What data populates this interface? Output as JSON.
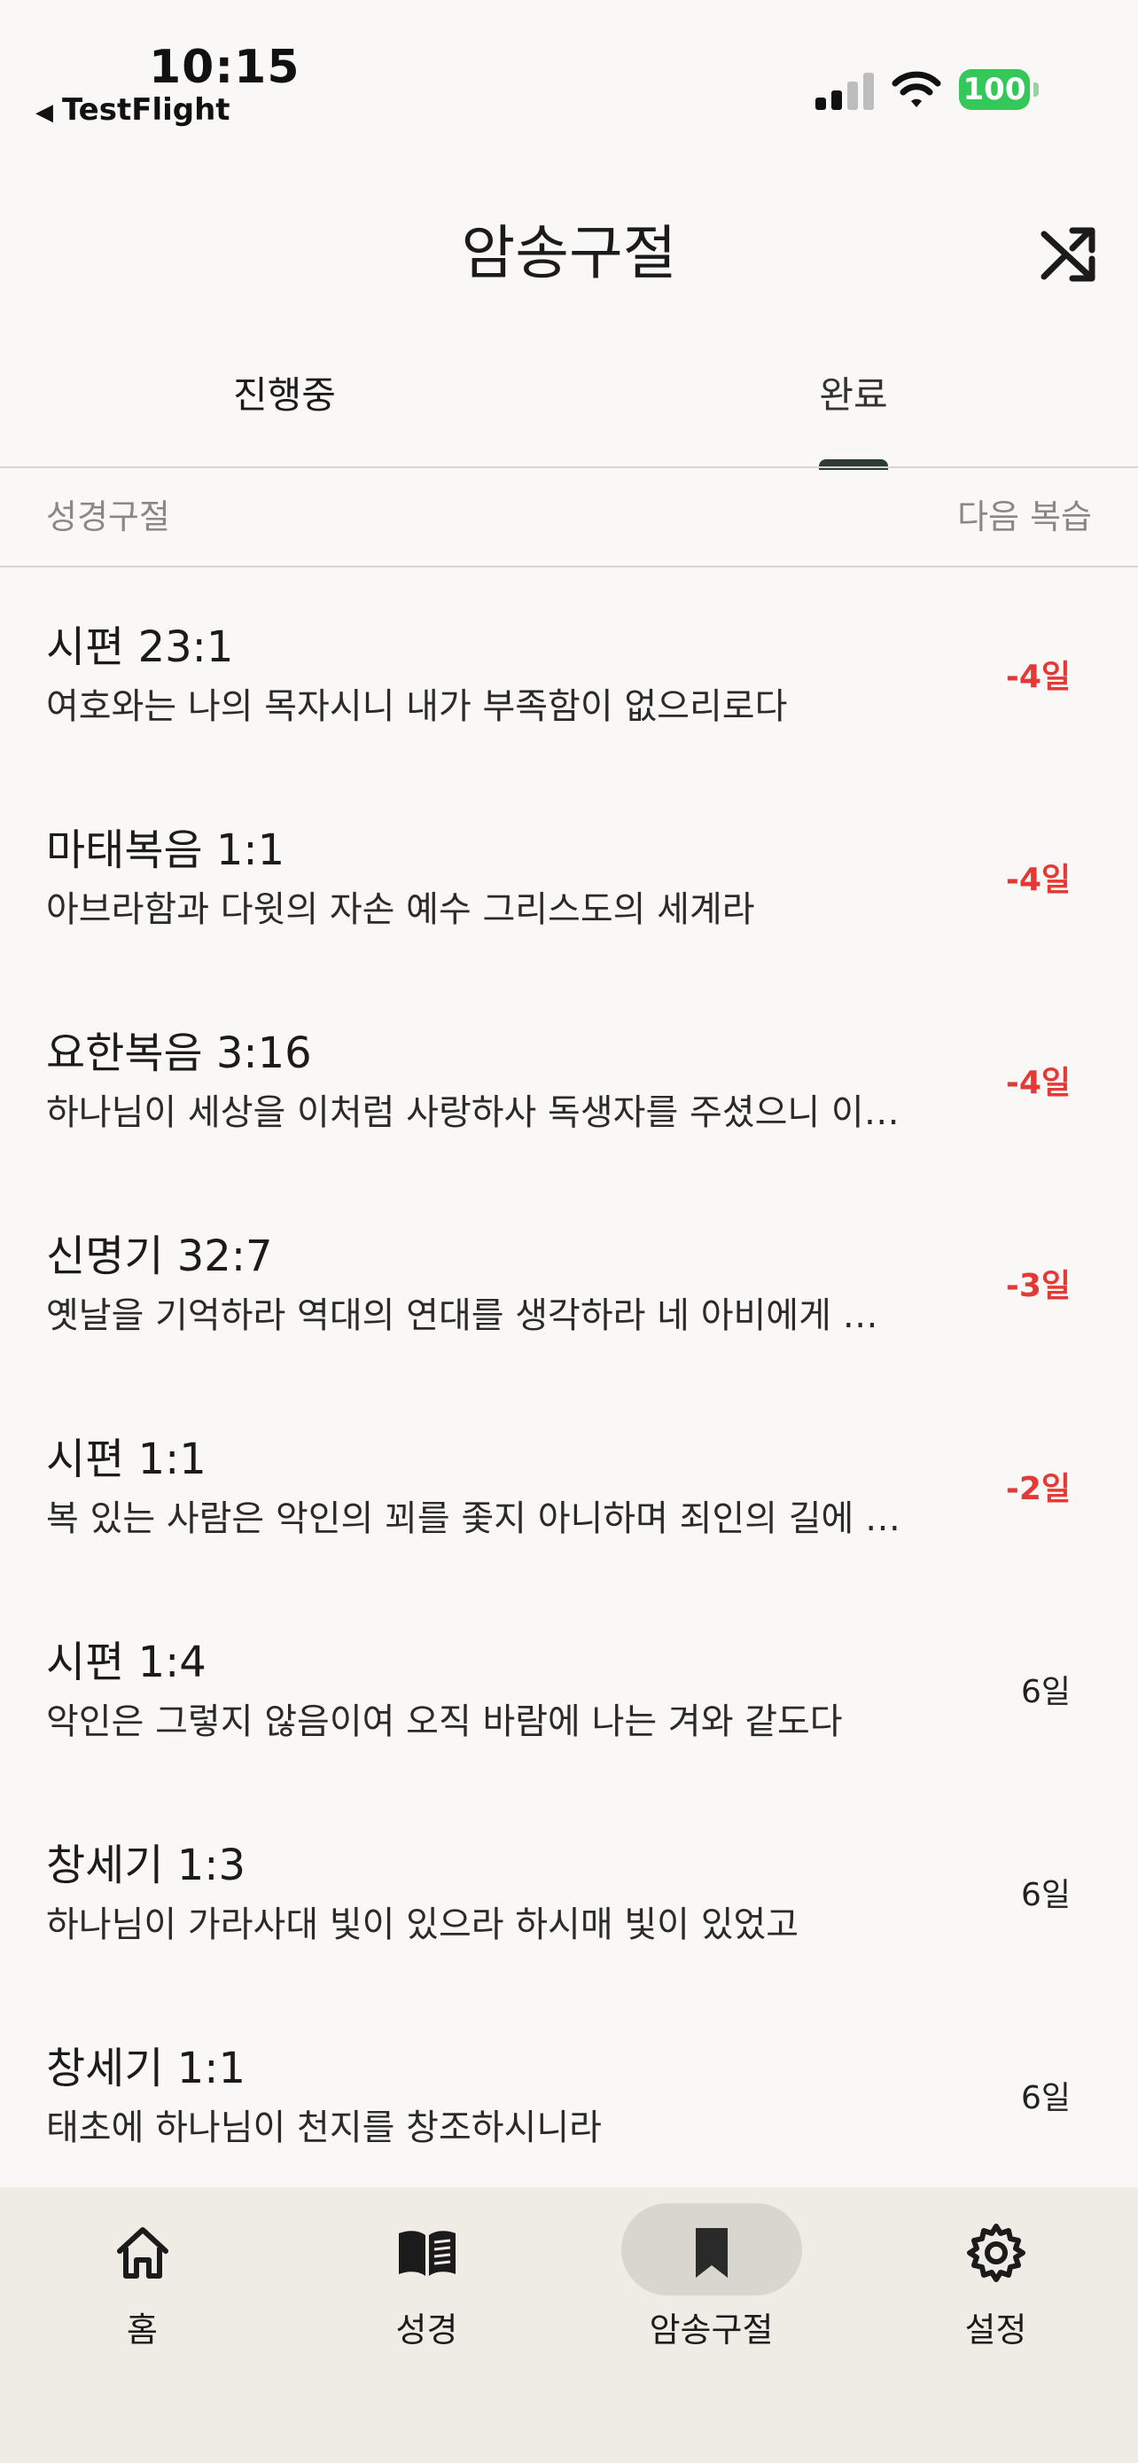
{
  "status": {
    "time": "10:15",
    "back_app": "TestFlight",
    "battery": "100"
  },
  "header": {
    "title": "암송구절"
  },
  "tabs": [
    {
      "label": "진행중",
      "active": false
    },
    {
      "label": "완료",
      "active": true
    }
  ],
  "columns": {
    "left": "성경구절",
    "right": "다음 복습"
  },
  "verses": [
    {
      "ref": "시편 23:1",
      "text": "여호와는 나의 목자시니 내가 부족함이 없으리로다",
      "due": "-4일",
      "overdue": true
    },
    {
      "ref": "마태복음 1:1",
      "text": "아브라함과 다윗의 자손 예수 그리스도의 세계라",
      "due": "-4일",
      "overdue": true
    },
    {
      "ref": "요한복음 3:16",
      "text": "하나님이 세상을 이처럼 사랑하사 독생자를 주셨으니 이…",
      "due": "-4일",
      "overdue": true
    },
    {
      "ref": "신명기 32:7",
      "text": "옛날을 기억하라 역대의 연대를 생각하라 네 아비에게 …",
      "due": "-3일",
      "overdue": true
    },
    {
      "ref": "시편 1:1",
      "text": "복 있는 사람은 악인의 꾀를 좇지 아니하며 죄인의 길에 …",
      "due": "-2일",
      "overdue": true
    },
    {
      "ref": "시편 1:4",
      "text": "악인은 그렇지 않음이여 오직 바람에 나는 겨와 같도다",
      "due": "6일",
      "overdue": false
    },
    {
      "ref": "창세기 1:3",
      "text": "하나님이 가라사대 빛이 있으라 하시매 빛이 있었고",
      "due": "6일",
      "overdue": false
    },
    {
      "ref": "창세기 1:1",
      "text": "태초에 하나님이 천지를 창조하시니라",
      "due": "6일",
      "overdue": false
    }
  ],
  "nav": [
    {
      "label": "홈",
      "icon": "home-icon",
      "active": false
    },
    {
      "label": "성경",
      "icon": "book-icon",
      "active": false
    },
    {
      "label": "암송구절",
      "icon": "bookmark-icon",
      "active": true
    },
    {
      "label": "설정",
      "icon": "gear-icon",
      "active": false
    }
  ],
  "colors": {
    "background": "#f9f8f6",
    "overdue": "#e53935",
    "tab_indicator": "#2f3a33",
    "nav_background": "#efece6",
    "nav_active_pill": "#d9d6d0",
    "battery": "#34c759"
  }
}
